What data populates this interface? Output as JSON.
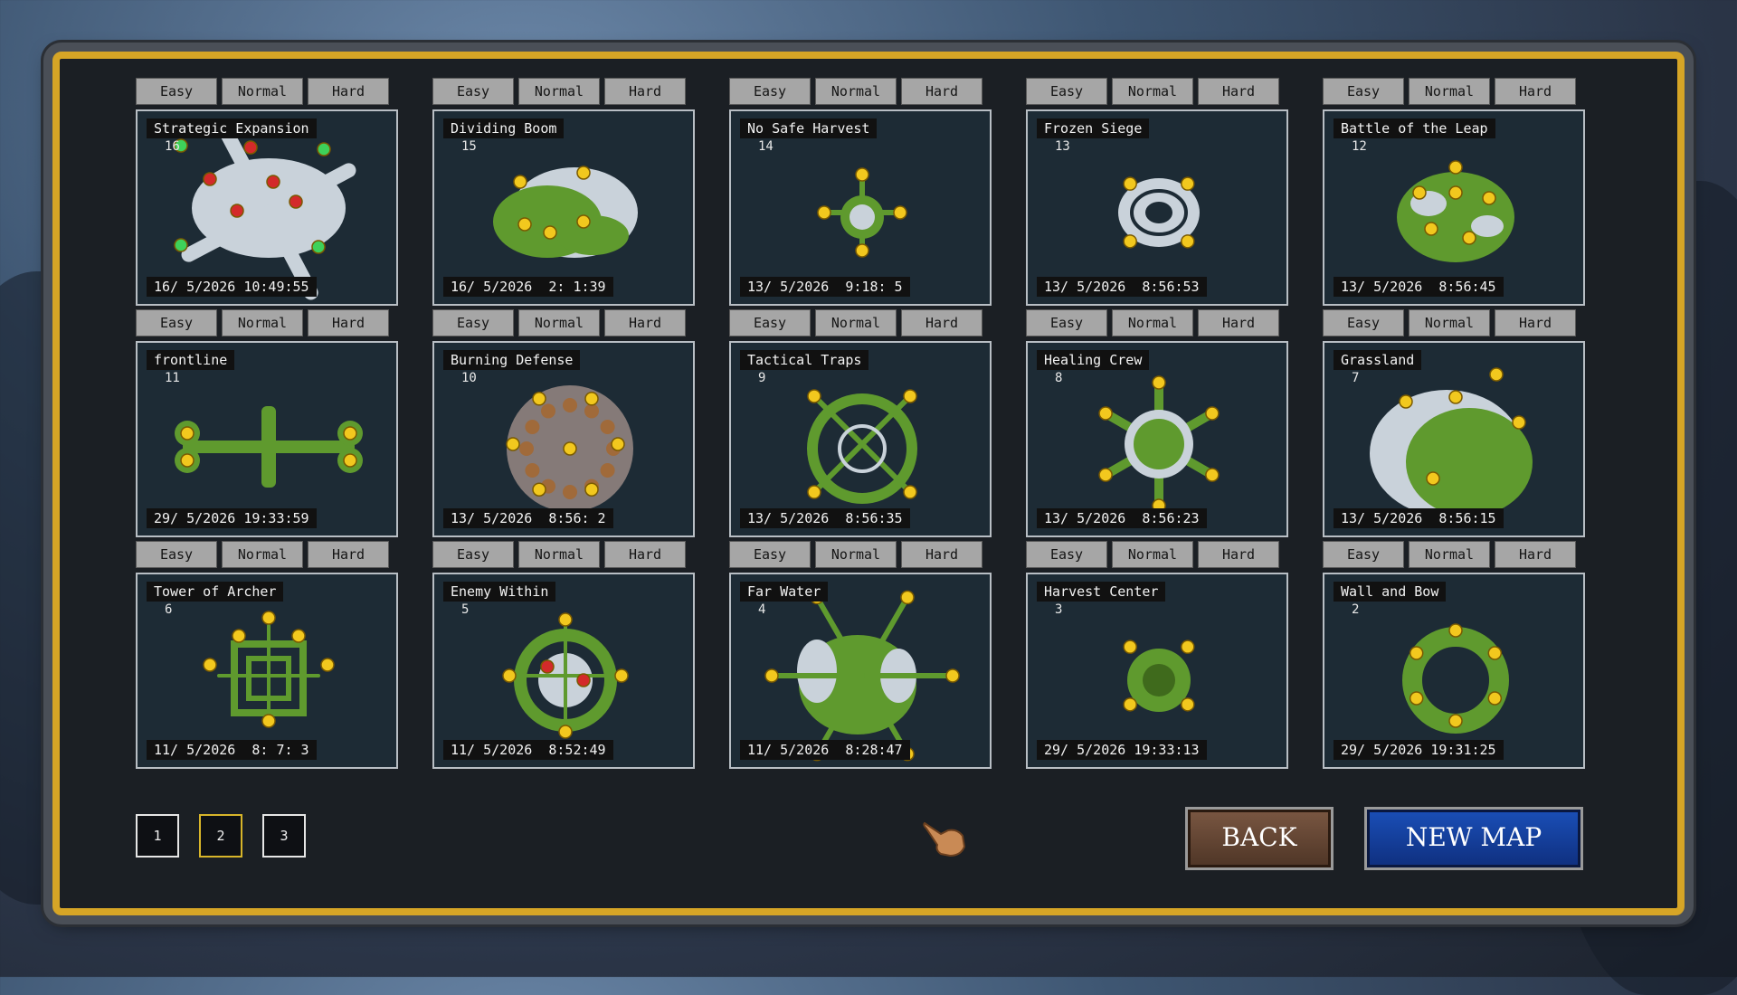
{
  "difficulty_labels": [
    "Easy",
    "Normal",
    "Hard"
  ],
  "maps": [
    {
      "title": "Strategic Expansion",
      "num": "16",
      "date": "16/ 5/2026 10:49:55",
      "style": "snow-red"
    },
    {
      "title": "Dividing Boom",
      "num": "15",
      "date": "16/ 5/2026  2: 1:39",
      "style": "mixed"
    },
    {
      "title": "No Safe Harvest",
      "num": "14",
      "date": "13/ 5/2026  9:18: 5",
      "style": "small-cross"
    },
    {
      "title": "Frozen Siege",
      "num": "13",
      "date": "13/ 5/2026  8:56:53",
      "style": "snow-ring"
    },
    {
      "title": "Battle of the Leap",
      "num": "12",
      "date": "13/ 5/2026  8:56:45",
      "style": "green-blob"
    },
    {
      "title": "frontline",
      "num": "11",
      "date": "29/ 5/2026 19:33:59",
      "style": "green-cross"
    },
    {
      "title": "Burning Defense",
      "num": "10",
      "date": "13/ 5/2026  8:56: 2",
      "style": "rock"
    },
    {
      "title": "Tactical Traps",
      "num": "9",
      "date": "13/ 5/2026  8:56:35",
      "style": "green-net"
    },
    {
      "title": "Healing Crew",
      "num": "8",
      "date": "13/ 5/2026  8:56:23",
      "style": "star"
    },
    {
      "title": "Grassland",
      "num": "7",
      "date": "13/ 5/2026  8:56:15",
      "style": "grass"
    },
    {
      "title": "Tower of Archer",
      "num": "6",
      "date": "11/ 5/2026  8: 7: 3",
      "style": "square"
    },
    {
      "title": "Enemy Within",
      "num": "5",
      "date": "11/ 5/2026  8:52:49",
      "style": "ring-red"
    },
    {
      "title": "Far Water",
      "num": "4",
      "date": "11/ 5/2026  8:28:47",
      "style": "water"
    },
    {
      "title": "Harvest Center",
      "num": "3",
      "date": "29/ 5/2026 19:33:13",
      "style": "small-green"
    },
    {
      "title": "Wall and Bow",
      "num": "2",
      "date": "29/ 5/2026 19:31:25",
      "style": "donut"
    }
  ],
  "pagination": {
    "pages": [
      "1",
      "2",
      "3"
    ],
    "current": "2"
  },
  "buttons": {
    "back": "BACK",
    "new_map": "NEW MAP"
  },
  "colors": {
    "frame_gold": "#d6a526",
    "card_bg": "#1d2b35",
    "back_brown": "#6a4a36",
    "new_blue": "#1a4fb8",
    "grass": "#5f9a2e",
    "snow": "#c9d2da",
    "gold_base": "#f2c81e"
  }
}
